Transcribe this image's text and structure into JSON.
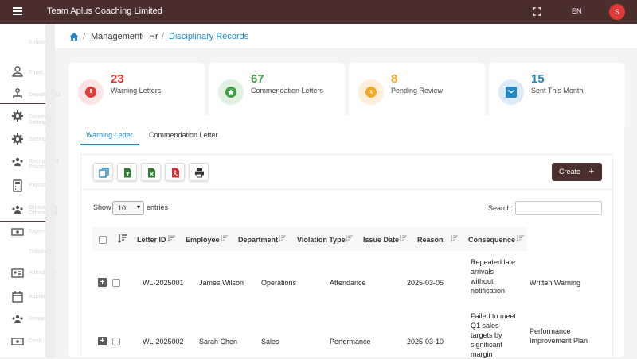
{
  "app": {
    "title": "Team Aplus Coaching Limited",
    "language": "EN",
    "avatar_initial": "S"
  },
  "breadcrumb": {
    "items": [
      "Management",
      "Hr"
    ],
    "active": "Disciplinary Records"
  },
  "stats": [
    {
      "value": "23",
      "label": "Warning Letters",
      "color": "#e53935",
      "bg": "#fde4e4"
    },
    {
      "value": "67",
      "label": "Commendation Letters",
      "color": "#43a047",
      "bg": "#e0f1e1"
    },
    {
      "value": "8",
      "label": "Pending Review",
      "color": "#f5a623",
      "bg": "#fdefdc"
    },
    {
      "value": "15",
      "label": "Sent This Month",
      "color": "#1e88c8",
      "bg": "#dcebf7"
    }
  ],
  "tabs": [
    "Warning Letter",
    "Commendation Letter"
  ],
  "toolbar": {
    "create_label": "Create",
    "create_icon": "+"
  },
  "table_controls": {
    "show_label": "Show",
    "page_size": "10",
    "entries_label": "entries",
    "search_label": "Search:",
    "search_value": ""
  },
  "table": {
    "headers": [
      "Letter ID",
      "Employee",
      "Department",
      "Violation Type",
      "Issue Date",
      "Reason",
      "Consequence"
    ],
    "rows": [
      {
        "expand": "+",
        "id": "WL-2025001",
        "employee": "James Wilson",
        "department": "Operations",
        "violation": "Attendance",
        "date": "2025-03-05",
        "reason_lines": [
          "Repeated late",
          "arrivals",
          "without",
          "notification"
        ],
        "consequence_lines": [
          "Written Warning"
        ]
      },
      {
        "expand": "+",
        "id": "WL-2025002",
        "employee": "Sarah Chen",
        "department": "Sales",
        "violation": "Performance",
        "date": "2025-03-10",
        "reason_lines": [
          "Failed to meet",
          "Q1 sales",
          "targets by",
          "significant",
          "margin"
        ],
        "consequence_lines": [
          "Performance",
          "Improvement Plan"
        ]
      }
    ]
  },
  "sidebar": {
    "ghost_labels": [
      "Employees",
      "Email",
      "Departments",
      "General Settings",
      "Settings",
      "Recruitment Process",
      "Payroll",
      "Onboarding Offboarding",
      "Expenses",
      "Training",
      "Attendance",
      "Appraisal",
      "Rewards",
      "Cash"
    ]
  }
}
